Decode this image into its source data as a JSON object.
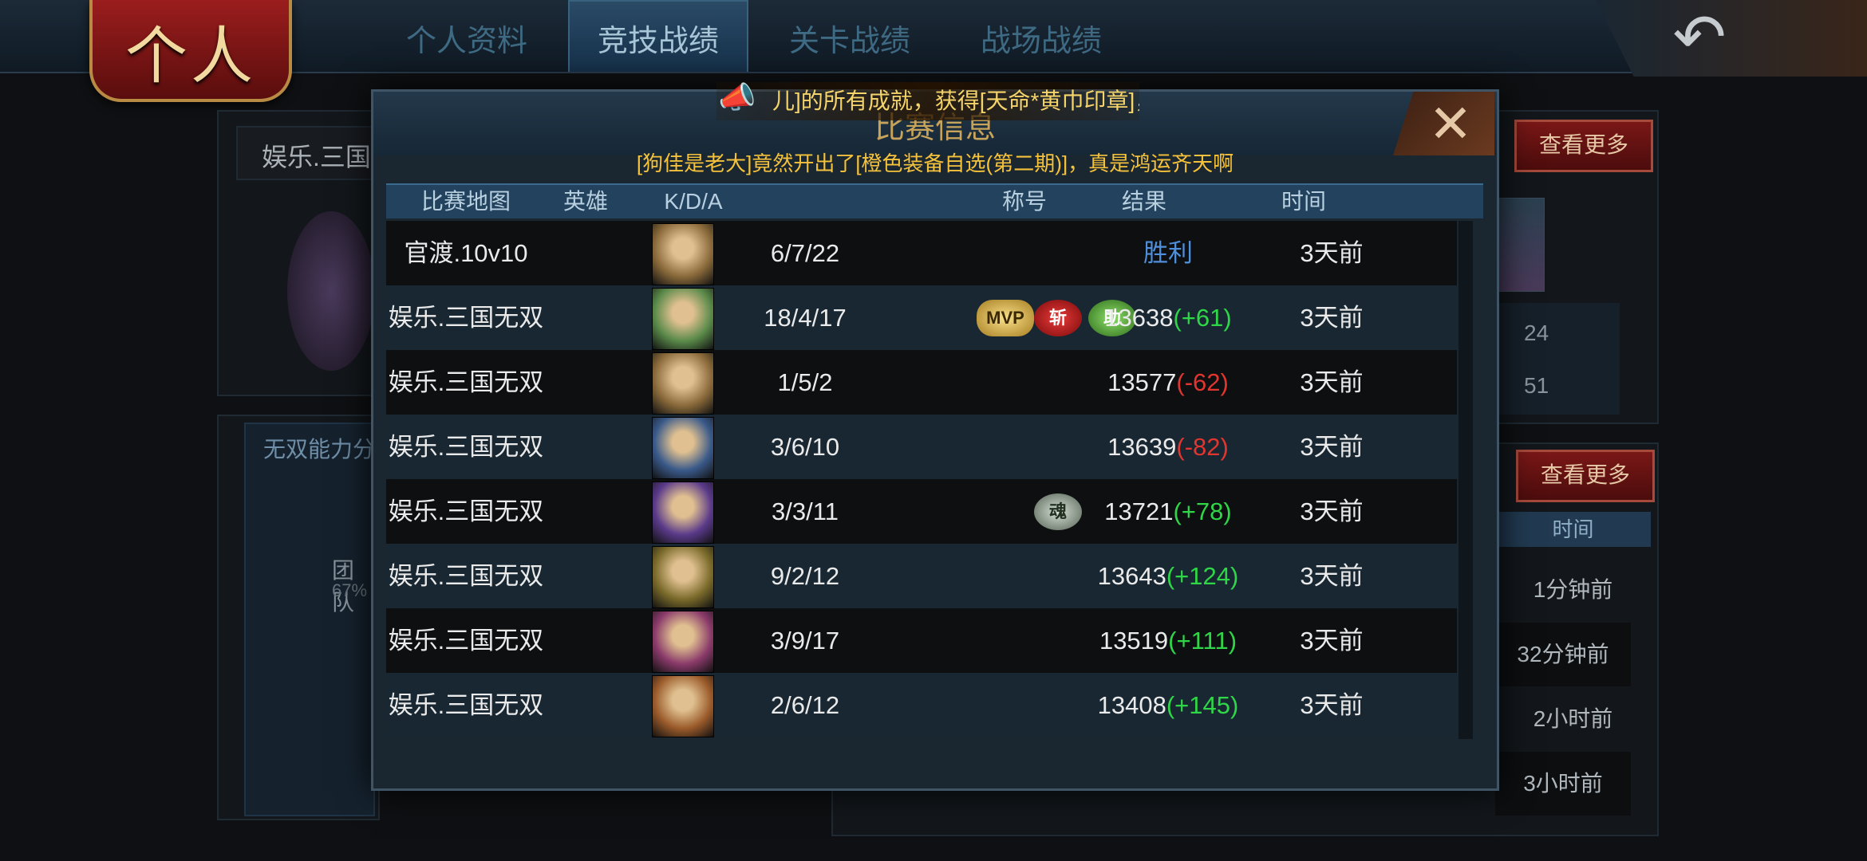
{
  "header": {
    "badge": "个人",
    "tabs": [
      {
        "label": "个人资料",
        "active": false
      },
      {
        "label": "竞技战绩",
        "active": true
      },
      {
        "label": "关卡战绩",
        "active": false
      },
      {
        "label": "战场战绩",
        "active": false
      }
    ],
    "back_icon": "back-arrow-icon"
  },
  "background": {
    "left_name_partial": "娱乐.三国无",
    "ability_label_partial": "无双能力分",
    "team_label_partial": "团队",
    "team_pct_partial": "67%",
    "more_button_top": "查看更多",
    "more_button_mid": "查看更多",
    "stat_1": "24",
    "stat_2": "51",
    "time_header": "时间",
    "times": [
      "1分钟前",
      "32分钟前",
      "2小时前",
      "3小时前"
    ]
  },
  "modal": {
    "title": "比赛信息",
    "ticker_text": "儿]的所有成就，获得[天命*黄巾印章]，i",
    "notice": "[狗佳是老大]竟然开出了[橙色装备自选(第二期)]，真是鸿运齐天啊",
    "columns": [
      "比赛地图",
      "英雄",
      "K/D/A",
      "称号",
      "结果",
      "时间"
    ],
    "rows": [
      {
        "map": "官渡.10v10",
        "kda": "6/7/22",
        "titles": [],
        "score": "",
        "delta": "胜利",
        "delta_type": "win",
        "time": "3天前",
        "hero_color": "#8a6a3a"
      },
      {
        "map": "娱乐.三国无双",
        "kda": "18/4/17",
        "titles": [
          "MVP",
          "斩",
          "助"
        ],
        "score": "13638",
        "delta": "(+61)",
        "delta_type": "ok",
        "time": "3天前",
        "hero_color": "#5a8a4a"
      },
      {
        "map": "娱乐.三国无双",
        "kda": "1/5/2",
        "titles": [],
        "score": "13577",
        "delta": "(-62)",
        "delta_type": "bad",
        "time": "3天前",
        "hero_color": "#8a6a3a"
      },
      {
        "map": "娱乐.三国无双",
        "kda": "3/6/10",
        "titles": [],
        "score": "13639",
        "delta": "(-82)",
        "delta_type": "bad",
        "time": "3天前",
        "hero_color": "#3a5a8a"
      },
      {
        "map": "娱乐.三国无双",
        "kda": "3/3/11",
        "titles": [
          "魂"
        ],
        "score": "13721",
        "delta": "(+78)",
        "delta_type": "ok",
        "time": "3天前",
        "hero_color": "#5a3a8a"
      },
      {
        "map": "娱乐.三国无双",
        "kda": "9/2/12",
        "titles": [],
        "score": "13643",
        "delta": "(+124)",
        "delta_type": "ok",
        "time": "3天前",
        "hero_color": "#7a6a2a"
      },
      {
        "map": "娱乐.三国无双",
        "kda": "3/9/17",
        "titles": [],
        "score": "13519",
        "delta": "(+111)",
        "delta_type": "ok",
        "time": "3天前",
        "hero_color": "#8a3a6a"
      },
      {
        "map": "娱乐.三国无双",
        "kda": "2/6/12",
        "titles": [],
        "score": "13408",
        "delta": "(+145)",
        "delta_type": "ok",
        "time": "3天前",
        "hero_color": "#9a5a2a"
      }
    ]
  }
}
